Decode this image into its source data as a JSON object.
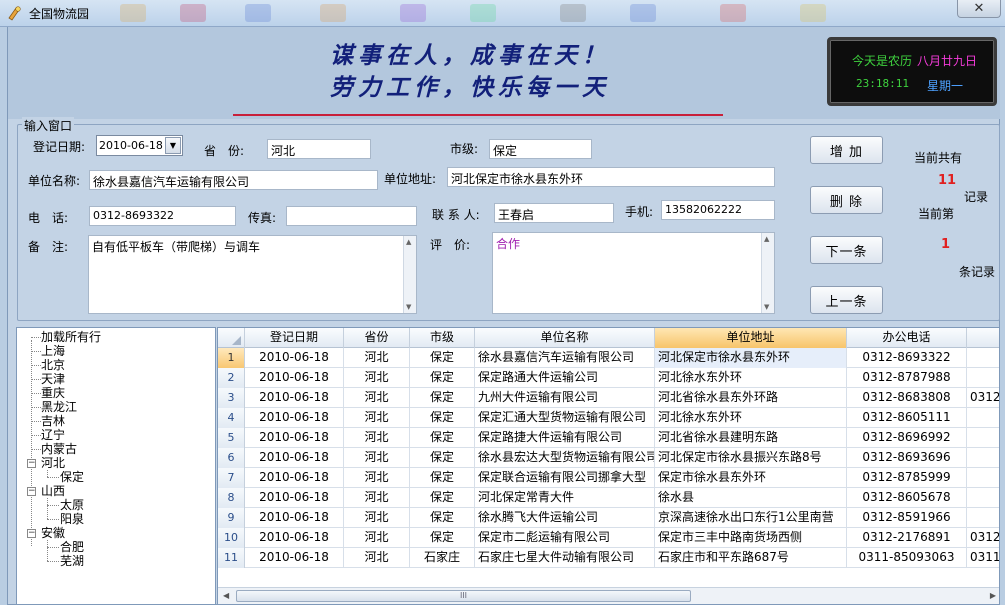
{
  "window": {
    "title": "全国物流园",
    "close_glyph": "✕"
  },
  "banner": {
    "slogan_line1": "谋事在人，成事在天！",
    "slogan_line2": "劳力工作，快乐每一天",
    "clock": {
      "lunar_label": "今天是农历",
      "lunar_date": "八月廿九日",
      "time": "23:18:11",
      "weekday": "星期一"
    }
  },
  "form": {
    "group_title": "输入窗口",
    "reg_date_label": "登记日期:",
    "reg_date_value": "2010-06-18",
    "province_label": "省　份:",
    "province_value": "河北",
    "city_label": "市级:",
    "city_value": "保定",
    "company_label": "单位名称:",
    "company_value": "徐水县嘉信汽车运输有限公司",
    "address_label": "单位地址:",
    "address_value": "河北保定市徐水县东外环",
    "phone_label": "电　话:",
    "phone_value": "0312-8693322",
    "fax_label": "传真:",
    "fax_value": "",
    "contact_label": "联 系 人:",
    "contact_value": "王春启",
    "mobile_label": "手机:",
    "mobile_value": "13582062222",
    "remark_label": "备　注:",
    "remark_value": "自有低平板车（带爬梯）与调车",
    "evaluation_label": "评　价:",
    "evaluation_value": "合作"
  },
  "buttons": {
    "add": "增 加",
    "delete": "删 除",
    "next": "下一条",
    "prev": "上一条"
  },
  "counter": {
    "total_label": "当前共有",
    "total_value": "11",
    "total_unit": "记录",
    "current_label": "当前第",
    "current_value": "1",
    "current_unit": "条记录"
  },
  "tree": {
    "root": "加载所有行",
    "items": [
      "上海",
      "北京",
      "天津",
      "重庆",
      "黑龙江",
      "吉林",
      "辽宁",
      "内蒙古"
    ],
    "hebei": {
      "label": "河北",
      "children": [
        "保定"
      ]
    },
    "shanxi": {
      "label": "山西",
      "children": [
        "太原",
        "阳泉"
      ]
    },
    "anhui": {
      "label": "安徽",
      "children": [
        "合肥",
        "芜湖"
      ]
    },
    "toggle_glyph": "−"
  },
  "grid": {
    "columns": [
      "登记日期",
      "省份",
      "市级",
      "单位名称",
      "单位地址",
      "办公电话",
      ""
    ],
    "rows": [
      [
        "1",
        "2010-06-18",
        "河北",
        "保定",
        "徐水县嘉信汽车运输有限公司",
        "河北保定市徐水县东外环",
        "0312-8693322",
        ""
      ],
      [
        "2",
        "2010-06-18",
        "河北",
        "保定",
        "保定路通大件运输公司",
        "河北徐水东外环",
        "0312-8787988",
        ""
      ],
      [
        "3",
        "2010-06-18",
        "河北",
        "保定",
        "九州大件运输有限公司",
        "河北省徐水县东外环路",
        "0312-8683808",
        "0312"
      ],
      [
        "4",
        "2010-06-18",
        "河北",
        "保定",
        "保定汇通大型货物运输有限公司",
        "河北徐水东外环",
        "0312-8605111",
        ""
      ],
      [
        "5",
        "2010-06-18",
        "河北",
        "保定",
        "保定路捷大件运输有限公司",
        "河北省徐水县建明东路",
        "0312-8696992",
        ""
      ],
      [
        "6",
        "2010-06-18",
        "河北",
        "保定",
        "徐水县宏达大型货物运输有限公司",
        "河北保定市徐水县振兴东路8号",
        "0312-8693696",
        ""
      ],
      [
        "7",
        "2010-06-18",
        "河北",
        "保定",
        "保定联合运输有限公司挪拿大型",
        "保定市徐水县东外环",
        "0312-8785999",
        ""
      ],
      [
        "8",
        "2010-06-18",
        "河北",
        "保定",
        "河北保定常青大件",
        "徐水县",
        "0312-8605678",
        ""
      ],
      [
        "9",
        "2010-06-18",
        "河北",
        "保定",
        "徐水腾飞大件运输公司",
        "京深高速徐水出口东行1公里南营",
        "0312-8591966",
        ""
      ],
      [
        "10",
        "2010-06-18",
        "河北",
        "保定",
        "保定市二彪运输有限公司",
        "保定市三丰中路南货场西侧",
        "0312-2176891",
        "0312"
      ],
      [
        "11",
        "2010-06-18",
        "河北",
        "石家庄",
        "石家庄七星大件动输有限公司",
        "石家庄市和平东路687号",
        "0311-85093063",
        "0311"
      ]
    ],
    "scroll_grip": "III",
    "scroll_left": "◀",
    "scroll_right": "▶"
  },
  "icons": {
    "app": "logistics-app-icon",
    "dropdown": "▼",
    "scroll_up": "▲",
    "scroll_down": "▼"
  }
}
